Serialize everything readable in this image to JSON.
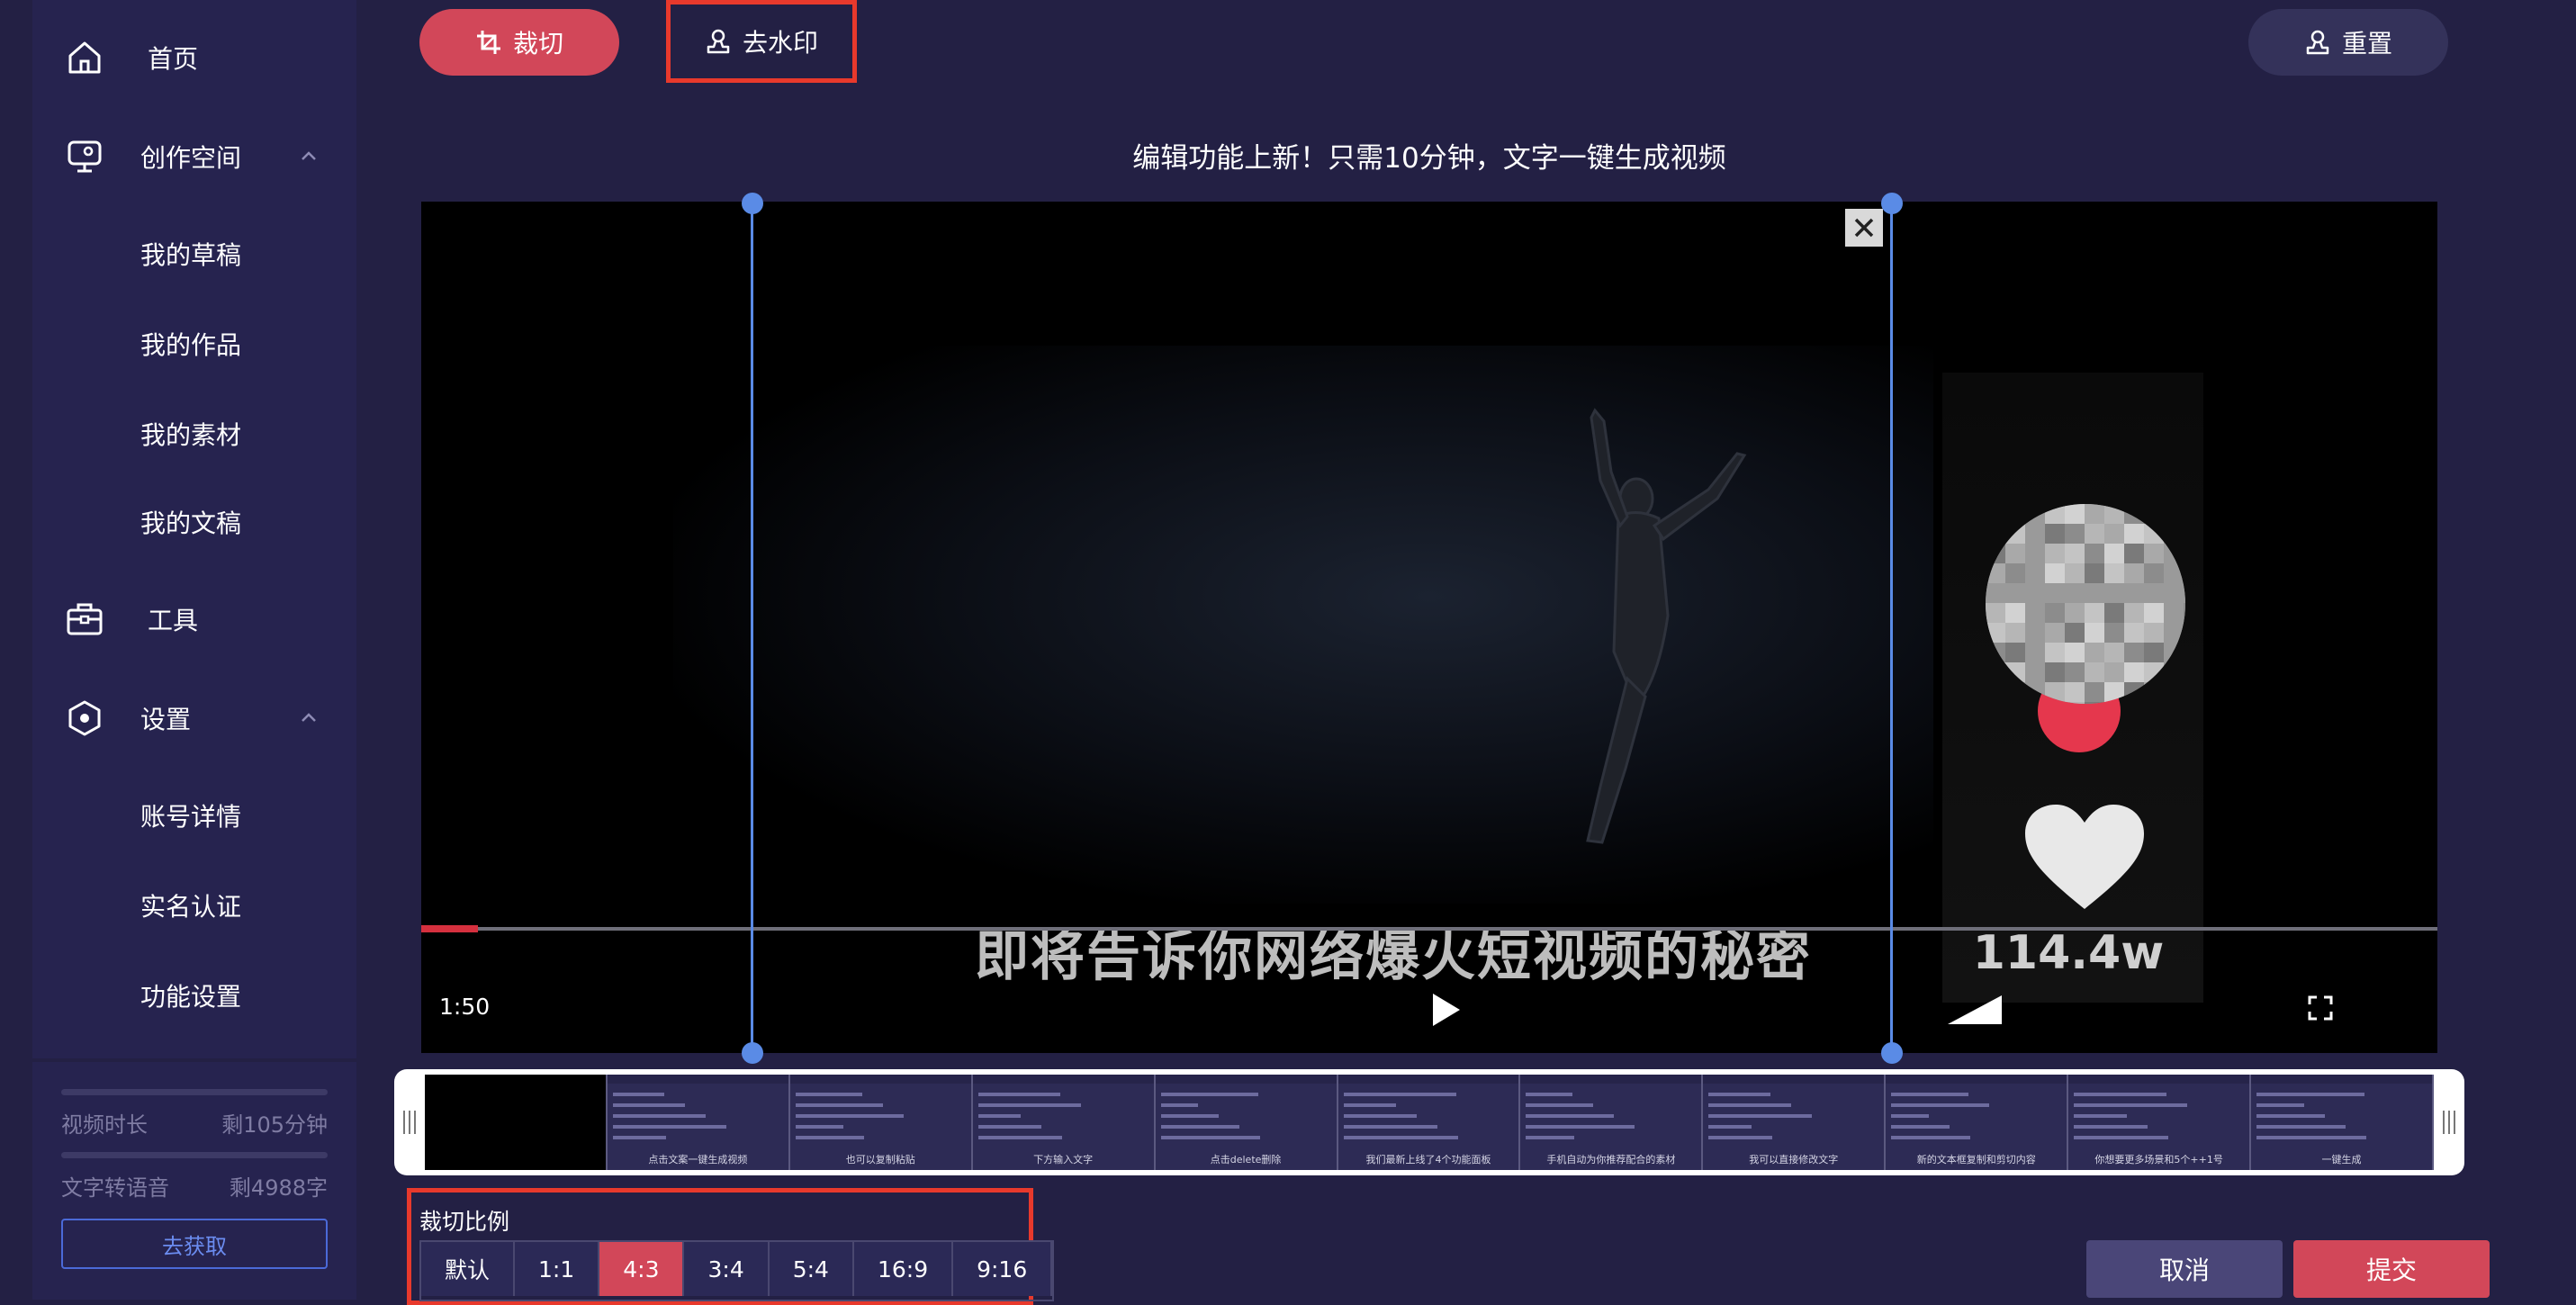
{
  "sidebar": {
    "items": [
      {
        "key": "home",
        "label": "首页",
        "icon": "home-icon"
      },
      {
        "key": "workspace",
        "label": "创作空间",
        "icon": "monitor-icon"
      },
      {
        "key": "drafts",
        "label": "我的草稿"
      },
      {
        "key": "works",
        "label": "我的作品"
      },
      {
        "key": "materials",
        "label": "我的素材"
      },
      {
        "key": "manuscripts",
        "label": "我的文稿"
      },
      {
        "key": "tools",
        "label": "工具",
        "icon": "toolbox-icon"
      },
      {
        "key": "settings",
        "label": "设置",
        "icon": "settings-icon"
      },
      {
        "key": "account",
        "label": "账号详情"
      },
      {
        "key": "verify",
        "label": "实名认证"
      },
      {
        "key": "feature_settings",
        "label": "功能设置"
      }
    ],
    "quota": {
      "video_label": "视频时长",
      "video_value": "剩105分钟",
      "tts_label": "文字转语音",
      "tts_value": "剩4988字",
      "get_button": "去获取"
    }
  },
  "toolbar": {
    "crop_label": "裁切",
    "watermark_label": "去水印",
    "reset_label": "重置"
  },
  "headline": "编辑功能上新！只需10分钟，文字一键生成视频",
  "video": {
    "subtitle": "即将告诉你网络爆火短视频的秘密",
    "like_count": "114.4w",
    "time": "1:50",
    "progress": 0.028
  },
  "timeline": {
    "captions": [
      "",
      "点击文案一键生成视频",
      "也可以复制粘贴",
      "下方输入文字",
      "点击delete删除",
      "我们最新上线了4个功能面板",
      "手机自动为你推荐配合的素材",
      "我可以直接修改文字",
      "新的文本框复制和剪切内容",
      "你想要更多场景和5个++1号",
      "一键生成"
    ]
  },
  "ratio": {
    "title": "裁切比例",
    "options": [
      "默认",
      "1:1",
      "4:3",
      "3:4",
      "5:4",
      "16:9",
      "9:16"
    ],
    "active": "4:3"
  },
  "actions": {
    "cancel": "取消",
    "submit": "提交"
  },
  "colors": {
    "accent": "#d24759",
    "highlight_box": "#e8392c",
    "crop_guide": "#5a8be6",
    "background": "#232044",
    "sidebar": "#26234f"
  }
}
